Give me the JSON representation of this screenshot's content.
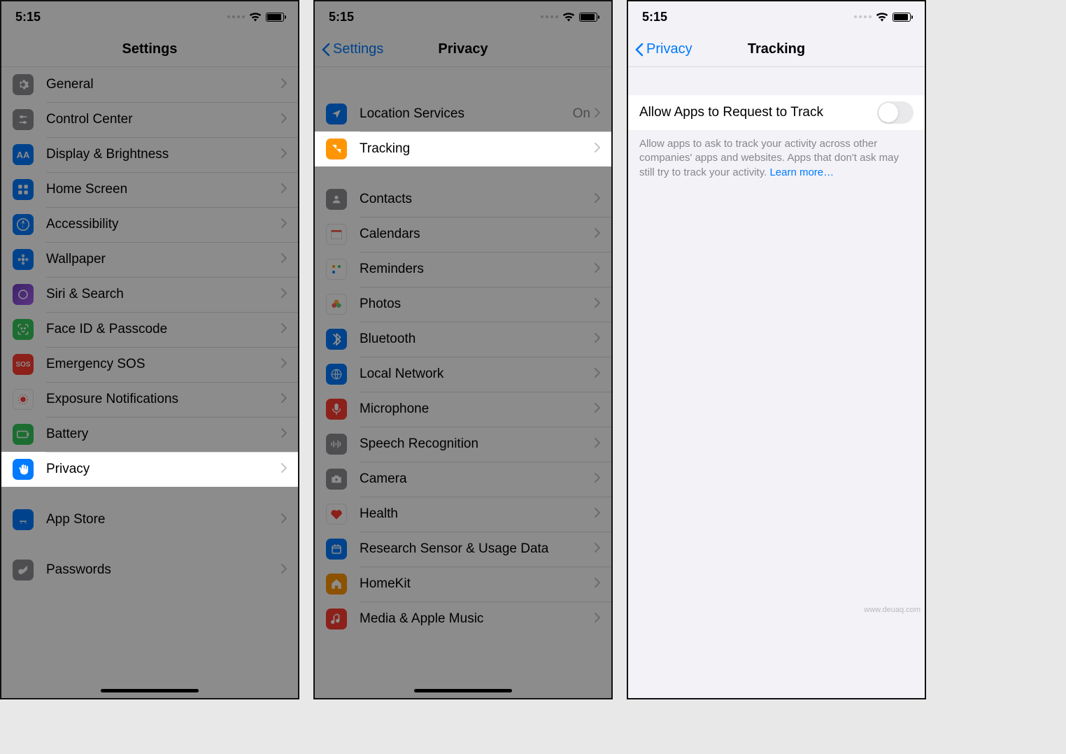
{
  "status": {
    "time": "5:15"
  },
  "screens": {
    "settings": {
      "title": "Settings",
      "groups": [
        [
          {
            "label": "General",
            "icon": "gear",
            "color": "bg-gray"
          },
          {
            "label": "Control Center",
            "icon": "sliders",
            "color": "bg-gray"
          },
          {
            "label": "Display & Brightness",
            "icon": "text",
            "color": "bg-blue"
          },
          {
            "label": "Home Screen",
            "icon": "grid",
            "color": "bg-blue"
          },
          {
            "label": "Accessibility",
            "icon": "accessibility",
            "color": "bg-blue"
          },
          {
            "label": "Wallpaper",
            "icon": "flower",
            "color": "bg-blue"
          },
          {
            "label": "Siri & Search",
            "icon": "siri",
            "color": "bg-purple"
          },
          {
            "label": "Face ID & Passcode",
            "icon": "faceid",
            "color": "bg-green"
          },
          {
            "label": "Emergency SOS",
            "icon": "sos",
            "color": "bg-red"
          },
          {
            "label": "Exposure Notifications",
            "icon": "exposure",
            "color": "bg-white"
          },
          {
            "label": "Battery",
            "icon": "battery",
            "color": "bg-green"
          },
          {
            "label": "Privacy",
            "icon": "hand",
            "color": "bg-blue",
            "highlight": true
          }
        ],
        [
          {
            "label": "App Store",
            "icon": "appstore",
            "color": "bg-blue"
          }
        ],
        [
          {
            "label": "Passwords",
            "icon": "key",
            "color": "bg-gray"
          }
        ]
      ]
    },
    "privacy": {
      "title": "Privacy",
      "back": "Settings",
      "groups": [
        [
          {
            "label": "Location Services",
            "icon": "location",
            "color": "bg-blue",
            "detail": "On"
          },
          {
            "label": "Tracking",
            "icon": "tracking",
            "color": "bg-orange",
            "highlight": true
          }
        ],
        [
          {
            "label": "Contacts",
            "icon": "contacts",
            "color": "bg-gray"
          },
          {
            "label": "Calendars",
            "icon": "calendar",
            "color": "bg-white"
          },
          {
            "label": "Reminders",
            "icon": "reminders",
            "color": "bg-white"
          },
          {
            "label": "Photos",
            "icon": "photos",
            "color": "bg-white"
          },
          {
            "label": "Bluetooth",
            "icon": "bluetooth",
            "color": "bg-blue"
          },
          {
            "label": "Local Network",
            "icon": "network",
            "color": "bg-blue"
          },
          {
            "label": "Microphone",
            "icon": "mic",
            "color": "bg-red"
          },
          {
            "label": "Speech Recognition",
            "icon": "speech",
            "color": "bg-gray"
          },
          {
            "label": "Camera",
            "icon": "camera",
            "color": "bg-gray"
          },
          {
            "label": "Health",
            "icon": "health",
            "color": "bg-white"
          },
          {
            "label": "Research Sensor & Usage Data",
            "icon": "research",
            "color": "bg-blue"
          },
          {
            "label": "HomeKit",
            "icon": "homekit",
            "color": "bg-orange"
          },
          {
            "label": "Media & Apple Music",
            "icon": "music",
            "color": "bg-red"
          }
        ]
      ]
    },
    "tracking": {
      "title": "Tracking",
      "back": "Privacy",
      "toggle_label": "Allow Apps to Request to Track",
      "footer": "Allow apps to ask to track your activity across other companies' apps and websites. Apps that don't ask may still try to track your activity. ",
      "learn_more": "Learn more…"
    }
  },
  "watermark": "www.deuaq.com"
}
